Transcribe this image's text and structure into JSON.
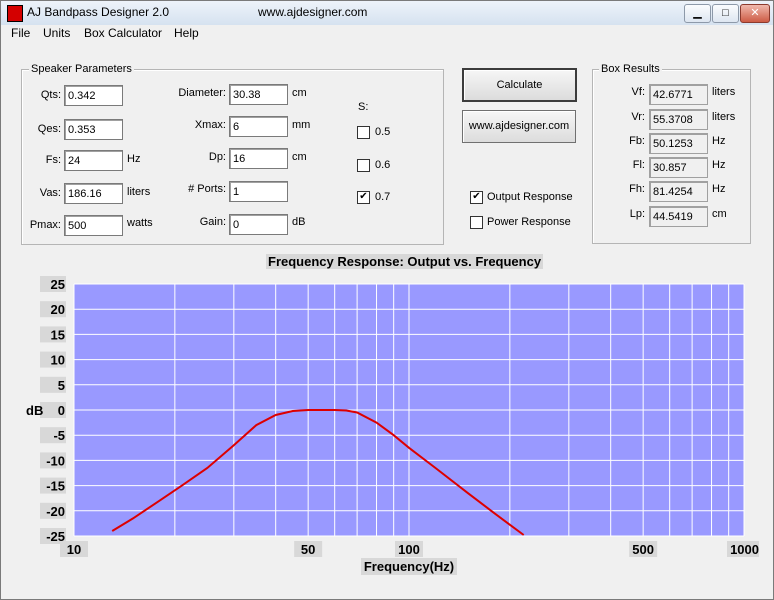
{
  "window": {
    "title": "AJ Bandpass Designer 2.0",
    "url": "www.ajdesigner.com",
    "minimize": "▁",
    "maximize": "□",
    "close": "✕"
  },
  "menu": [
    "File",
    "Units",
    "Box Calculator",
    "Help"
  ],
  "speaker": {
    "legend": "Speaker Parameters",
    "qts": {
      "label": "Qts:",
      "value": "0.342"
    },
    "qes": {
      "label": "Qes:",
      "value": "0.353"
    },
    "fs": {
      "label": "Fs:",
      "value": "24",
      "unit": "Hz"
    },
    "vas": {
      "label": "Vas:",
      "value": "186.16",
      "unit": "liters"
    },
    "pmax": {
      "label": "Pmax:",
      "value": "500",
      "unit": "watts"
    },
    "diameter": {
      "label": "Diameter:",
      "value": "30.38",
      "unit": "cm"
    },
    "xmax": {
      "label": "Xmax:",
      "value": "6",
      "unit": "mm"
    },
    "dp": {
      "label": "Dp:",
      "value": "16",
      "unit": "cm"
    },
    "ports": {
      "label": "# Ports:",
      "value": "1"
    },
    "gain": {
      "label": "Gain:",
      "value": "0",
      "unit": "dB"
    },
    "s": {
      "label": "S:",
      "options": [
        {
          "label": "0.5",
          "checked": false
        },
        {
          "label": "0.6",
          "checked": false
        },
        {
          "label": "0.7",
          "checked": true
        }
      ]
    }
  },
  "buttons": {
    "calculate": "Calculate",
    "website": "www.ajdesigner.com"
  },
  "response": {
    "output": {
      "label": "Output Response",
      "checked": true
    },
    "power": {
      "label": "Power Response",
      "checked": false
    }
  },
  "results": {
    "legend": "Box Results",
    "vf": {
      "label": "Vf:",
      "value": "42.6771",
      "unit": "liters"
    },
    "vr": {
      "label": "Vr:",
      "value": "55.3708",
      "unit": "liters"
    },
    "fb": {
      "label": "Fb:",
      "value": "50.1253",
      "unit": "Hz"
    },
    "fl": {
      "label": "Fl:",
      "value": "30.857",
      "unit": "Hz"
    },
    "fh": {
      "label": "Fh:",
      "value": "81.4254",
      "unit": "Hz"
    },
    "lp": {
      "label": "Lp:",
      "value": "44.5419",
      "unit": "cm"
    }
  },
  "chart_data": {
    "type": "line",
    "title": "Frequency Response: Output vs. Frequency",
    "xlabel": "Frequency(Hz)",
    "ylabel": "dB",
    "xscale": "log",
    "xlim": [
      10,
      1000
    ],
    "ylim": [
      -25,
      25
    ],
    "xticks": [
      "10",
      "50",
      "100",
      "500",
      "1000"
    ],
    "yticks": [
      "25",
      "20",
      "15",
      "10",
      "5",
      "0",
      "-5",
      "-10",
      "-15",
      "-20",
      "-25"
    ],
    "grid": true,
    "plot_bg": "#9999ff",
    "series": [
      {
        "color": "#dd0000",
        "x": [
          13,
          15,
          18,
          21,
          25,
          30,
          35,
          40,
          45,
          50,
          55,
          60,
          65,
          70,
          80,
          90,
          100,
          120,
          150,
          180,
          220
        ],
        "y": [
          -24,
          -21.5,
          -18,
          -15,
          -11.5,
          -7,
          -3,
          -1,
          -0.2,
          0,
          0,
          0,
          -0.1,
          -0.5,
          -2.5,
          -5,
          -7.5,
          -11.5,
          -16.5,
          -20.5,
          -24.8
        ]
      }
    ]
  }
}
